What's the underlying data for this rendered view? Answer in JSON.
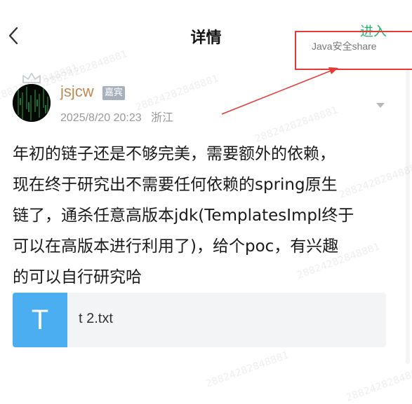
{
  "header": {
    "title": "详情",
    "enter_label": "进入",
    "share_label": "Java安全share"
  },
  "post": {
    "username": "jsjcw",
    "badge": "嘉宾",
    "timestamp": "2025/8/20 20:23",
    "location": "浙江",
    "content_lines": [
      "年初的链子还是不够完美，需要额外的依赖，",
      "现在终于研究出不需要任何依赖的spring原生",
      "链了，通杀任意高版本jdk(TemplatesImpl终于",
      "可以在高版本进行利用了)，给个poc，有兴趣",
      "的可以自行研究哈"
    ],
    "attachment": {
      "icon_letter": "T",
      "file_name": "t 2.txt"
    }
  },
  "watermark_text": "28824282848881",
  "colors": {
    "accent_green": "#27b36f",
    "annotation_red": "#e53935",
    "username_color": "#c08a55",
    "file_icon_blue": "#4aaef0"
  },
  "icons": [
    "back-chevron-icon",
    "crown-icon",
    "more-dropdown-icon",
    "text-file-icon"
  ]
}
